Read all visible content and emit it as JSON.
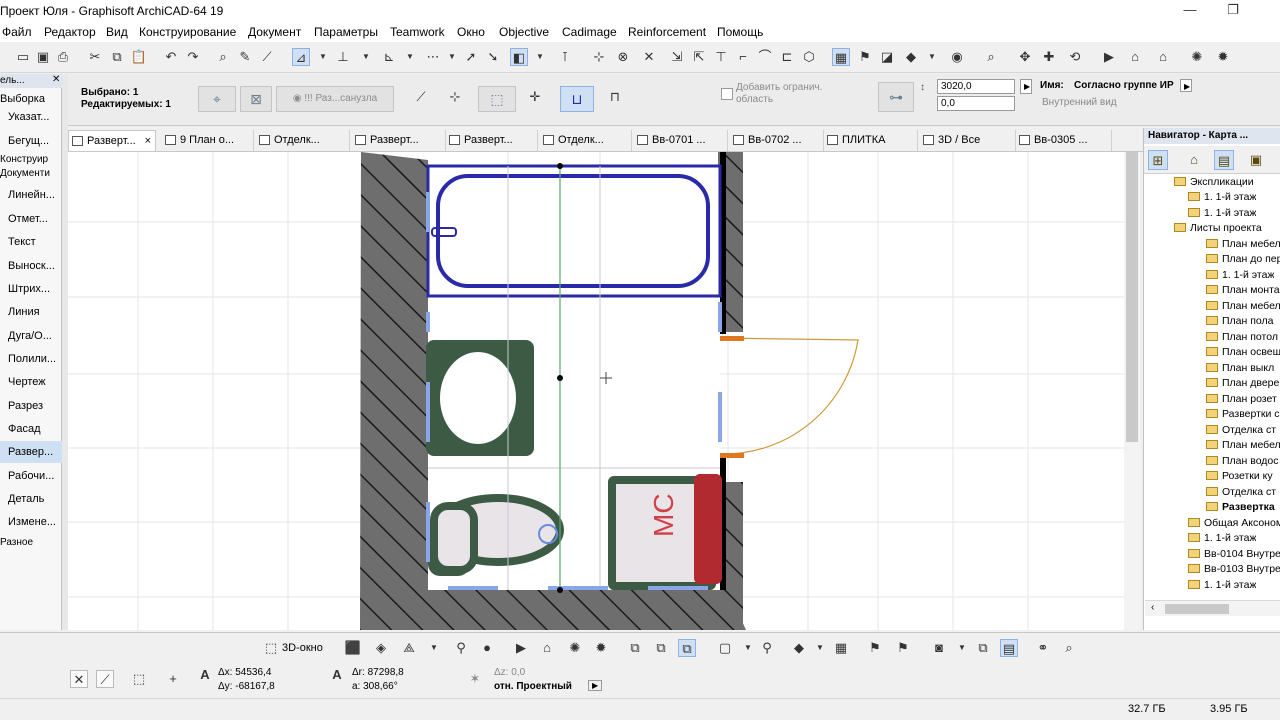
{
  "window": {
    "title": "Проект Юля - Graphisoft ArchiCAD-64 19"
  },
  "menu": [
    "Файл",
    "Редактор",
    "Вид",
    "Конструирование",
    "Документ",
    "Параметры",
    "Teamwork",
    "Окно",
    "Objective",
    "Cadimage",
    "Reinforcement",
    "Помощь"
  ],
  "infobox": {
    "selected": "Выбрано: 1",
    "editable": "Редактируемых: 1",
    "mode_label": "!!! Раз...санузла",
    "add_boundary": "Добавить огранич. область",
    "value1": "3020,0",
    "value2": "0,0",
    "name_label": "Имя:",
    "name_value": "Согласно группе ИР",
    "view_label": "Внутренний вид"
  },
  "toolbox": {
    "header": "ель...",
    "items": [
      "Выборка",
      "Указат...",
      "Бегущ...",
      "Конструир",
      "Документи",
      "Линейн...",
      "Отмет...",
      "Текст",
      "Выноск...",
      "Штрих...",
      "Линия",
      "Дуга/О...",
      "Полили...",
      "Чертеж",
      "Разрез",
      "Фасад",
      "Развер...",
      "Рабочи...",
      "Деталь",
      "Измене...",
      "Разное"
    ]
  },
  "tabs": [
    {
      "label": "Разверт...",
      "active": true,
      "close": "×"
    },
    {
      "label": "9 План о..."
    },
    {
      "label": "Отделк..."
    },
    {
      "label": "Разверт..."
    },
    {
      "label": "Разверт..."
    },
    {
      "label": "Отделк..."
    },
    {
      "label": "Вв-0701 ..."
    },
    {
      "label": "Вв-0702 ..."
    },
    {
      "label": "ПЛИТКА"
    },
    {
      "label": "3D / Все"
    },
    {
      "label": "Вв-0305 ..."
    }
  ],
  "drawing": {
    "label_mc": "МС"
  },
  "navigator": {
    "title": "Навигатор - Карта ...",
    "items": [
      {
        "label": "Экспликации",
        "level": 2
      },
      {
        "label": "1. 1-й этаж",
        "level": 3
      },
      {
        "label": "1. 1-й этаж",
        "level": 3
      },
      {
        "label": "Листы проекта",
        "level": 2
      },
      {
        "label": "План мебел",
        "level": 4
      },
      {
        "label": "План до пер",
        "level": 4
      },
      {
        "label": "1. 1-й этаж",
        "level": 4
      },
      {
        "label": "План монта",
        "level": 4
      },
      {
        "label": "План мебел",
        "level": 4
      },
      {
        "label": "План пола",
        "level": 4
      },
      {
        "label": "План потол",
        "level": 4
      },
      {
        "label": "План освещ",
        "level": 4
      },
      {
        "label": "План выкл",
        "level": 4
      },
      {
        "label": "План двере",
        "level": 4
      },
      {
        "label": "План розет",
        "level": 4
      },
      {
        "label": "Развертки с",
        "level": 4
      },
      {
        "label": "Отделка ст",
        "level": 4
      },
      {
        "label": "План мебел",
        "level": 4
      },
      {
        "label": "План водос",
        "level": 4
      },
      {
        "label": "Розетки ку",
        "level": 4
      },
      {
        "label": "Отделка ст",
        "level": 4
      },
      {
        "label": "Развертка",
        "level": 4,
        "selected": true
      },
      {
        "label": "Общая Аксоном",
        "level": 2
      },
      {
        "label": "1. 1-й этаж",
        "level": 3
      },
      {
        "label": "Вв-0104 Внутре",
        "level": 3
      },
      {
        "label": "Вв-0103 Внутре",
        "level": 3
      },
      {
        "label": "1. 1-й этаж",
        "level": 3
      }
    ]
  },
  "bottom_toolbar": {
    "view3d_label": "3D-окно"
  },
  "coords": {
    "dx": "Δx: 54536,4",
    "dy": "Δy: -68167,8",
    "dr": "Δr: 87298,8",
    "angle": "a: 308,66°",
    "dz": "Δz: 0,0",
    "ref": "отн. Проектный"
  },
  "status": {
    "disk1": "32.7 ГБ",
    "disk2": "3.95 ГБ"
  },
  "colors": {
    "accent": "#2a2aa8",
    "fixture_green": "#3c5a44",
    "door_orange": "#e07820",
    "highlight": "#cfe0f4",
    "wall_dark": "#555555"
  }
}
